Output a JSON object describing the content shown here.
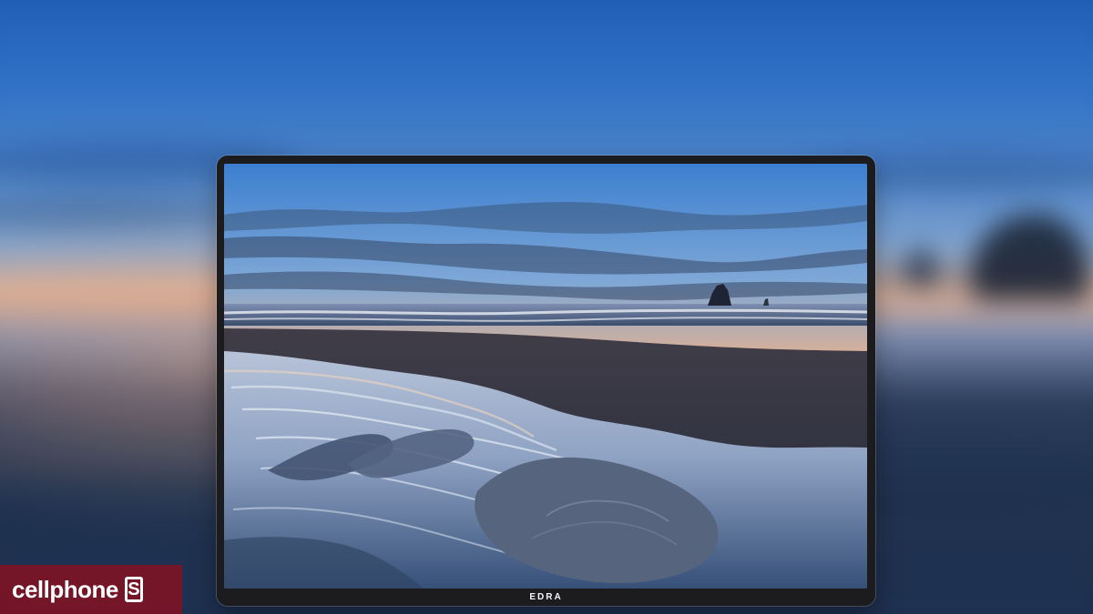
{
  "device": {
    "logo_text": "EDRA"
  },
  "watermark": {
    "brand_text": "cellphone",
    "brand_letter": "S",
    "background_color": "#8b1023"
  },
  "scene": {
    "subject": "sunset beach wallpaper",
    "sky_colors": [
      "#1d58b2",
      "#7ea3cf",
      "#e5b191"
    ],
    "sand_color": "#1d3050"
  }
}
